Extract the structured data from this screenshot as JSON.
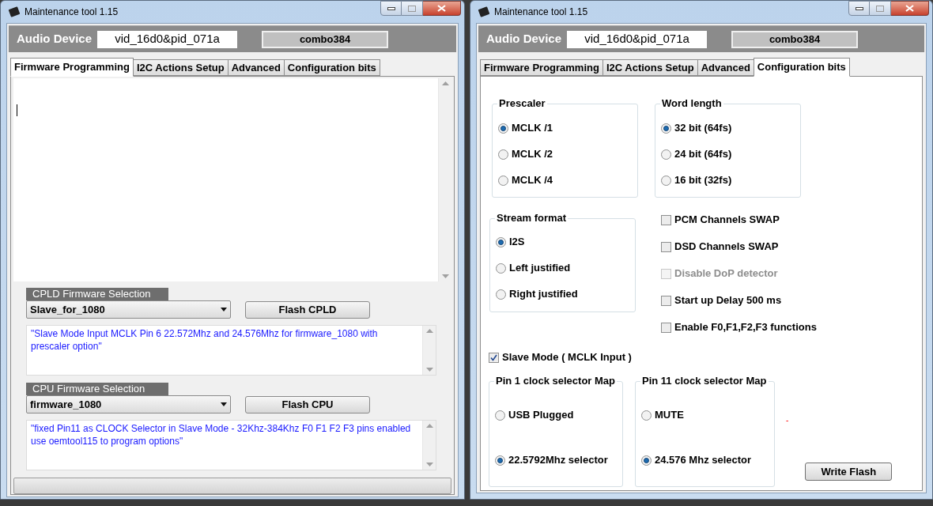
{
  "windows": [
    {
      "title": "Maintenance tool 1.15",
      "device_label": "Audio Device",
      "device_id": "vid_16d0&pid_071a",
      "device_name": "combo384",
      "tabs": [
        {
          "label": "Firmware Programming",
          "selected": true
        },
        {
          "label": "I2C Actions Setup",
          "selected": false
        },
        {
          "label": "Advanced",
          "selected": false
        },
        {
          "label": "Configuration bits",
          "selected": false
        }
      ],
      "panel": {
        "kind": "firmware",
        "sections": [
          {
            "title": "CPLD Firmware Selection",
            "selection": "Slave_for_1080",
            "button": "Flash CPLD",
            "description": "\"Slave Mode Input MCLK Pin 6 22.572Mhz and 24.576Mhz for firmware_1080 with prescaler option\""
          },
          {
            "title": "CPU Firmware Selection",
            "selection": "firmware_1080",
            "button": "Flash CPU",
            "description": "\"fixed Pin11 as CLOCK Selector in Slave Mode - 32Khz-384Khz F0 F1 F2 F3 pins enabled use oemtool115 to program options\""
          }
        ],
        "progress": {
          "level": 0
        }
      }
    },
    {
      "title": "Maintenance tool 1.15",
      "device_label": "Audio Device",
      "device_id": "vid_16d0&pid_071a",
      "device_name": "combo384",
      "tabs": [
        {
          "label": "Firmware Programming",
          "selected": false
        },
        {
          "label": "I2C Actions Setup",
          "selected": false
        },
        {
          "label": "Advanced",
          "selected": false
        },
        {
          "label": "Configuration bits",
          "selected": true
        }
      ],
      "panel": {
        "kind": "config",
        "groups": [
          {
            "title": "Prescaler",
            "options": [
              {
                "label": "MCLK /1",
                "selected": true
              },
              {
                "label": "MCLK /2",
                "selected": false
              },
              {
                "label": "MCLK /4",
                "selected": false
              }
            ]
          },
          {
            "title": "Word length",
            "options": [
              {
                "label": "32 bit (64fs)",
                "selected": true
              },
              {
                "label": "24 bit (64fs)",
                "selected": false
              },
              {
                "label": "16 bit (32fs)",
                "selected": false
              }
            ]
          },
          {
            "title": "Stream format",
            "options": [
              {
                "label": "I2S",
                "selected": true
              },
              {
                "label": "Left justified",
                "selected": false
              },
              {
                "label": "Right justified",
                "selected": false
              }
            ]
          }
        ],
        "checkboxes": [
          {
            "label": "PCM Channels SWAP",
            "checked": false,
            "disabled": false
          },
          {
            "label": "DSD Channels SWAP",
            "checked": false,
            "disabled": false
          },
          {
            "label": "Disable DoP detector",
            "checked": false,
            "disabled": true
          },
          {
            "label": "Start up Delay 500 ms",
            "checked": false,
            "disabled": false
          },
          {
            "label": "Enable F0,F1,F2,F3 functions",
            "checked": false,
            "disabled": false
          }
        ],
        "slave_mode": {
          "label": "Slave Mode ( MCLK Input )",
          "checked": true
        },
        "pin_maps": [
          {
            "title": "Pin 1 clock selector Map",
            "options": [
              {
                "label": "USB Plugged",
                "selected": false
              },
              {
                "label": "22.5792Mhz selector",
                "selected": true
              }
            ]
          },
          {
            "title": "Pin 11 clock selector Map",
            "options": [
              {
                "label": "MUTE",
                "selected": false
              },
              {
                "label": "24.576 Mhz selector",
                "selected": true
              }
            ]
          }
        ],
        "status_mark": "-",
        "button": "Write Flash"
      }
    }
  ]
}
